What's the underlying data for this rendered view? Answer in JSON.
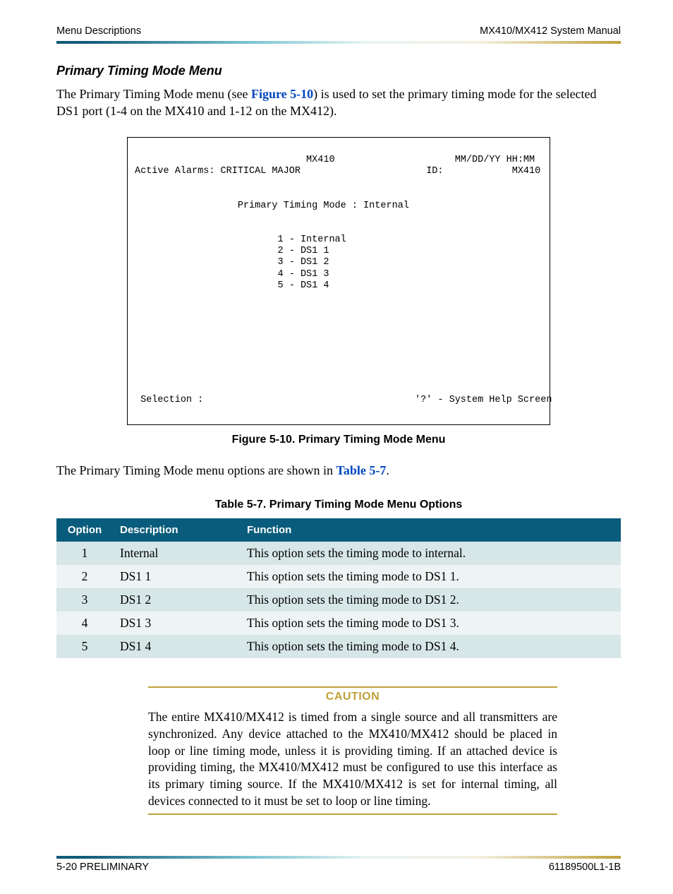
{
  "header": {
    "left": "Menu Descriptions",
    "right": "MX410/MX412 System Manual"
  },
  "section_title": "Primary Timing Mode Menu",
  "intro": {
    "pre": "The Primary Timing Mode menu (see ",
    "link": "Figure 5-10",
    "post": ") is used to set the primary timing mode for the selected DS1 port (1-4 on the MX410 and 1-12 on the MX412)."
  },
  "terminal": {
    "l1_left": "",
    "title_center": "MX410",
    "l1_right": "MM/DD/YY HH:MM",
    "l2_left": "Active Alarms: CRITICAL MAJOR",
    "l2_mid": "ID:",
    "l2_right": "MX410",
    "mode_line": "Primary Timing Mode : Internal",
    "opt1": "1 - Internal",
    "opt2": "2 - DS1 1",
    "opt3": "3 - DS1 2",
    "opt4": "4 - DS1 3",
    "opt5": "5 - DS1 4",
    "sel": "Selection :",
    "help": "'?' - System Help Screen"
  },
  "figure_caption": "Figure 5-10.  Primary Timing Mode Menu",
  "options_intro": {
    "pre": "The Primary Timing Mode menu options are shown in ",
    "link": "Table 5-7",
    "post": "."
  },
  "table_caption": "Table 5-7.  Primary Timing Mode Menu Options",
  "table": {
    "headers": {
      "option": "Option",
      "desc": "Description",
      "func": "Function"
    },
    "rows": [
      {
        "option": "1",
        "desc": "Internal",
        "func": "This option sets the timing mode to internal."
      },
      {
        "option": "2",
        "desc": "DS1 1",
        "func": "This option sets the timing mode to DS1 1."
      },
      {
        "option": "3",
        "desc": "DS1 2",
        "func": "This option sets the timing mode to DS1 2."
      },
      {
        "option": "4",
        "desc": "DS1 3",
        "func": "This option sets the timing mode to DS1 3."
      },
      {
        "option": "5",
        "desc": "DS1 4",
        "func": "This option sets the timing mode to DS1 4."
      }
    ]
  },
  "caution": {
    "label": "CAUTION",
    "text": "The entire MX410/MX412 is timed from a single source and all transmitters are synchronized. Any device attached to the MX410/MX412 should be placed in loop or line timing mode, unless it is providing timing. If an attached device is providing timing, the MX410/MX412 must be configured to use this interface as its primary timing source. If the MX410/MX412 is set for internal timing, all devices connected to it must be set to loop or line timing."
  },
  "footer": {
    "left": "5-20   PRELIMINARY",
    "right": "61189500L1-1B"
  }
}
